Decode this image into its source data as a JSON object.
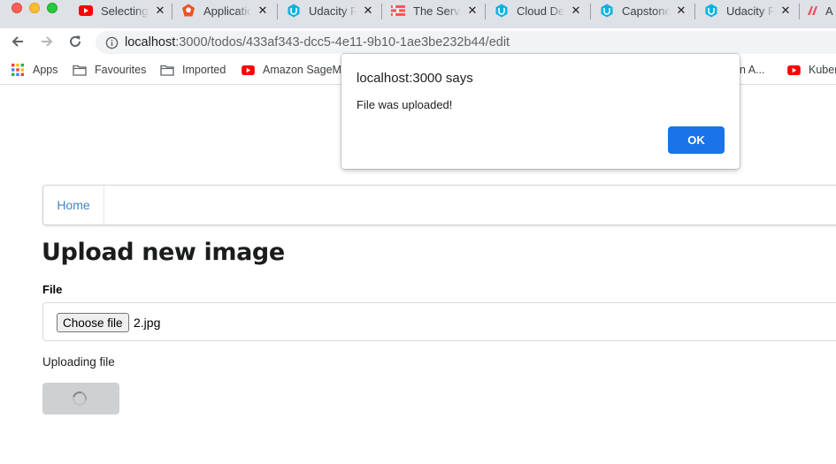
{
  "browser": {
    "tabs": [
      {
        "title": "Selecting",
        "icon": "youtube-icon"
      },
      {
        "title": "Applicatio",
        "icon": "auth0-icon"
      },
      {
        "title": "Udacity R",
        "icon": "udacity-icon"
      },
      {
        "title": "The Serve",
        "icon": "serverless-icon"
      },
      {
        "title": "Cloud De",
        "icon": "udacity-icon"
      },
      {
        "title": "Capstone",
        "icon": "udacity-icon"
      },
      {
        "title": "Udacity R",
        "icon": "udacity-icon"
      },
      {
        "title": "A",
        "icon": "kubernetes-icon"
      }
    ],
    "close_glyph": "✕",
    "url": {
      "host": "localhost",
      "rest": ":3000/todos/433af343-dcc5-4e11-9b10-1ae3be232b44/edit"
    },
    "bookmarks": [
      {
        "label": "Apps",
        "icon": "apps-grid-icon"
      },
      {
        "label": "Favourites",
        "icon": "folder-icon"
      },
      {
        "label": "Imported",
        "icon": "folder-icon"
      },
      {
        "label": "Amazon SageMa",
        "icon": "youtube-icon"
      },
      {
        "label": "n A...",
        "icon": ""
      },
      {
        "label": "Kuber",
        "icon": "youtube-icon"
      }
    ]
  },
  "page": {
    "nav": {
      "home_label": "Home"
    },
    "heading": "Upload new image",
    "file_field": {
      "label": "File",
      "button_label": "Choose file",
      "selected_file": "2.jpg"
    },
    "status_text": "Uploading file",
    "upload_button": {
      "loading": true
    }
  },
  "dialog": {
    "title": "localhost:3000 says",
    "message": "File was uploaded!",
    "ok_label": "OK"
  },
  "colors": {
    "link": "#4183c4",
    "primary_button": "#1a73e8",
    "youtube_red": "#ff0000",
    "udacity_blue": "#02b3e4"
  }
}
